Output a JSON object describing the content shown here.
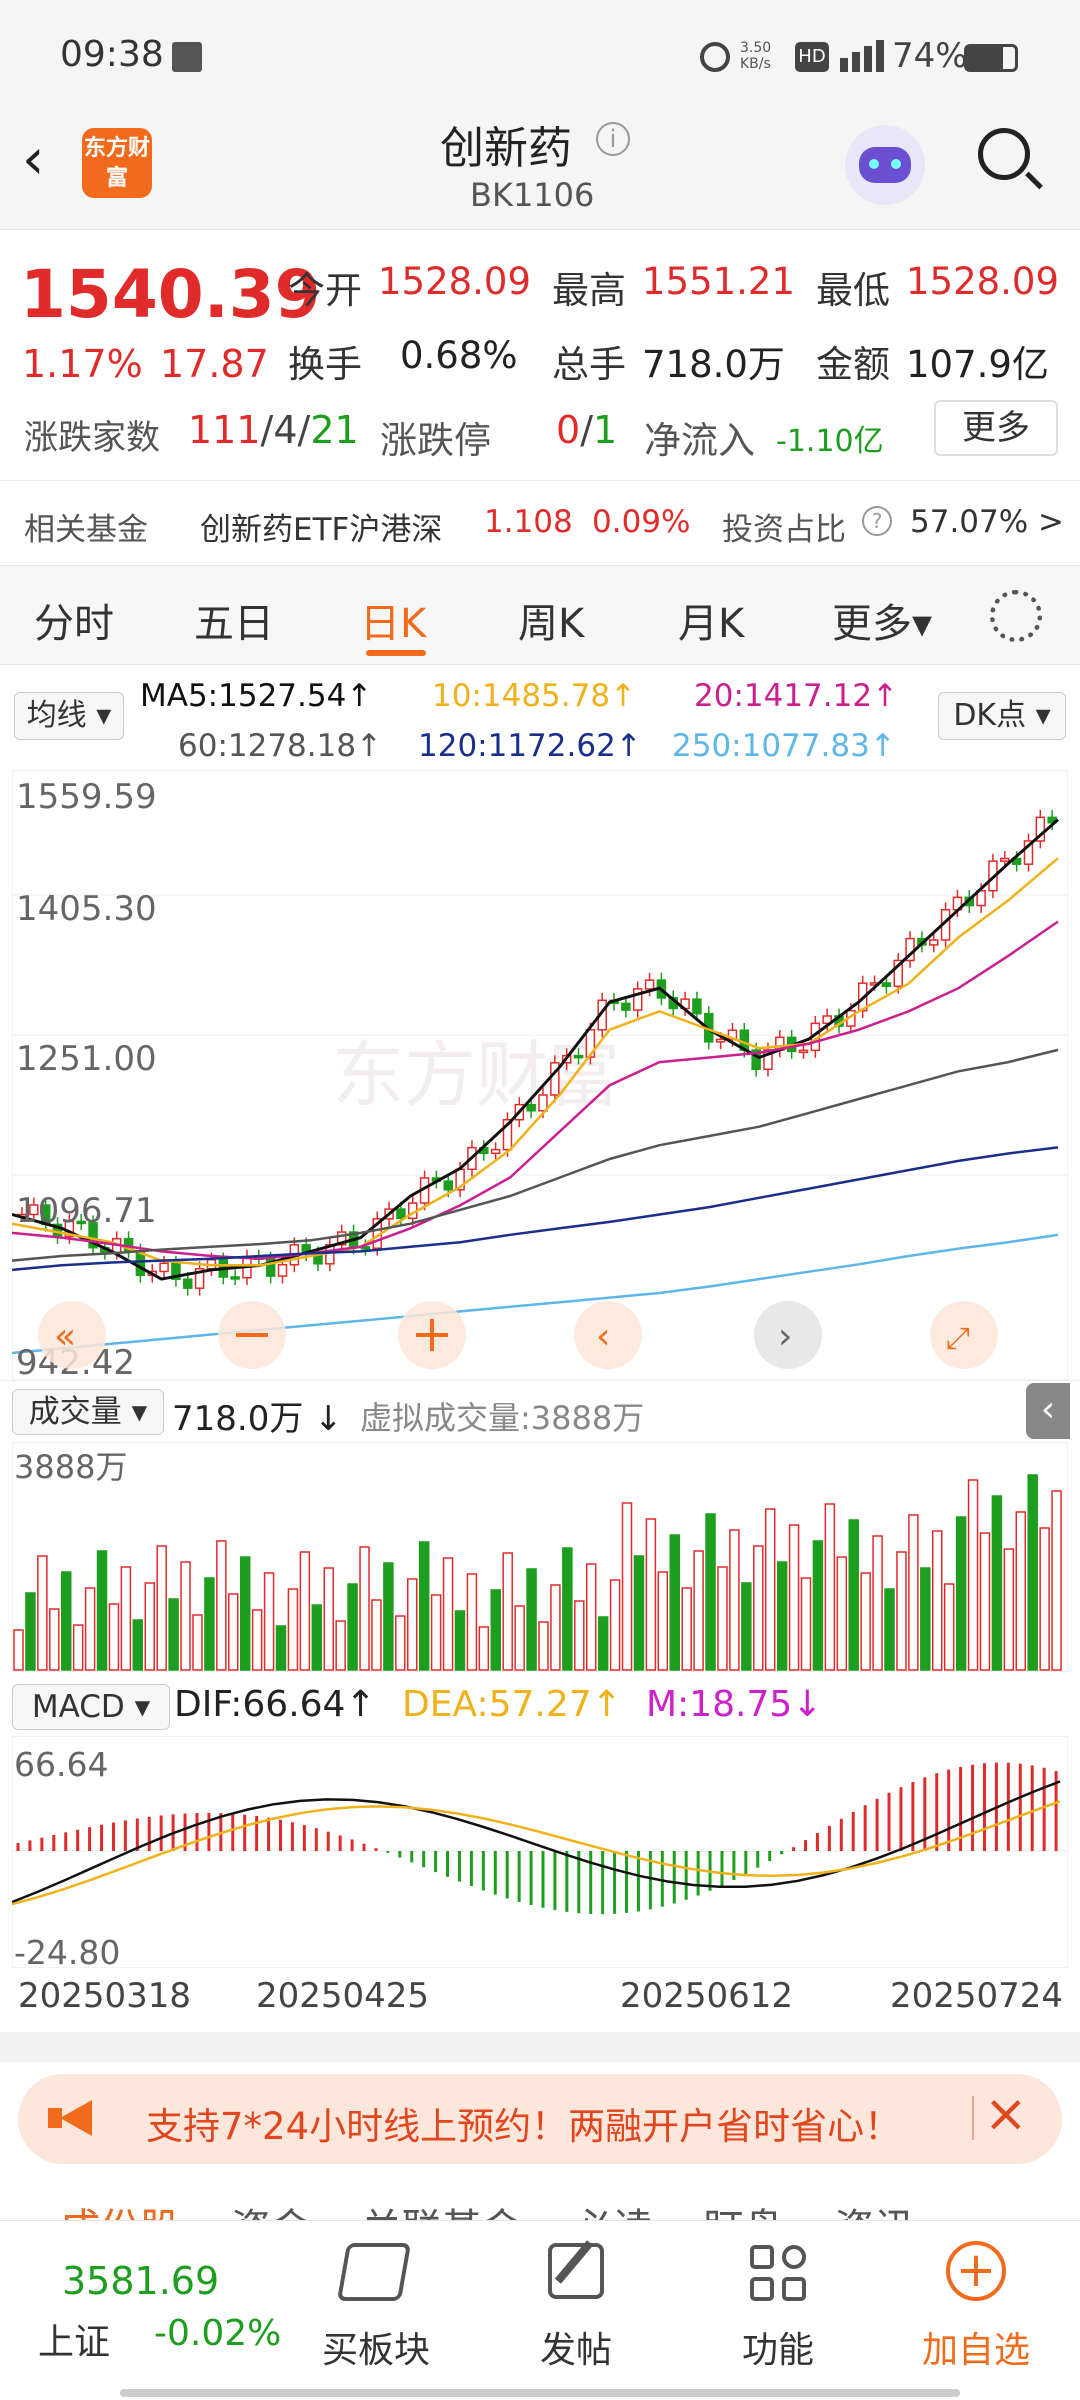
{
  "status": {
    "time": "09:38",
    "speed": "3.50 KB/s",
    "battery": "74%"
  },
  "header": {
    "logo": "东方财富",
    "title": "创新药",
    "code": "BK1106"
  },
  "quote": {
    "price": "1540.39",
    "pct": "1.17%",
    "change": "17.87",
    "open_label": "今开",
    "open": "1528.09",
    "high_label": "最高",
    "high": "1551.21",
    "low_label": "最低",
    "low": "1528.09",
    "turnover_label": "换手",
    "turnover": "0.68%",
    "vol_label": "总手",
    "vol": "718.0万",
    "amount_label": "金额",
    "amount": "107.9亿",
    "updown_label": "涨跌家数",
    "up": "111",
    "flat": "4",
    "down": "21",
    "limit_label": "涨跌停",
    "limit_up": "0",
    "limit_down": "1",
    "netflow_label": "净流入",
    "netflow": "-1.10亿",
    "more": "更多",
    "fund_label": "相关基金",
    "fund_name": "创新药ETF沪港深",
    "fund_price": "1.108",
    "fund_pct": "0.09%",
    "invest_label": "投资占比",
    "invest_pct": "57.07% >"
  },
  "tabs": [
    "分时",
    "五日",
    "日K",
    "周K",
    "月K",
    "更多▾"
  ],
  "ma": {
    "selector": "均线 ▾",
    "ma5": "MA5:1527.54↑",
    "ma10": "10:1485.78↑",
    "ma20": "20:1417.12↑",
    "ma60": "60:1278.18↑",
    "ma120": "120:1172.62↑",
    "ma250": "250:1077.83↑",
    "dk": "DK点 ▾"
  },
  "yaxis": [
    "1559.59",
    "1405.30",
    "1251.00",
    "1096.71",
    "942.42"
  ],
  "watermark": "东方财富",
  "volume": {
    "selector": "成交量 ▾",
    "value": "718.0万 ↓",
    "virtual": "虚拟成交量:3888万",
    "max": "3888万"
  },
  "macd": {
    "selector": "MACD ▾",
    "dif": "DIF:66.64↑",
    "dea": "DEA:57.27↑",
    "m": "M:18.75↓",
    "top": "66.64",
    "bottom": "-24.80"
  },
  "dates": [
    "20250318",
    "20250425",
    "20250612",
    "20250724"
  ],
  "banner": {
    "text": "支持7*24小时线上预约！两融开户省时省心！"
  },
  "subtabs": "成份股    资金    关联基金    必读    盯盘    资讯",
  "nav": {
    "index_value": "3581.69",
    "index_name": "上证",
    "index_pct": "-0.02%",
    "items": [
      "买板块",
      "发帖",
      "功能",
      "加自选"
    ]
  },
  "colors": {
    "up": "#e12b2b",
    "down": "#1e9e1e",
    "accent": "#f26b1d",
    "ma5": "#111111",
    "ma10": "#f0b21a",
    "ma20": "#cc1f8f",
    "ma60": "#555555",
    "ma120": "#1a2e8c",
    "ma250": "#5fb6e8"
  },
  "chart_data": {
    "type": "line",
    "title": "日K",
    "x_range": [
      "20250318",
      "20250724"
    ],
    "ylim": [
      942.42,
      1559.59
    ],
    "series": [
      {
        "name": "MA5",
        "values": [
          1100,
          1085,
          1060,
          1030,
          1040,
          1045,
          1060,
          1075,
          1120,
          1150,
          1200,
          1260,
          1330,
          1345,
          1300,
          1270,
          1290,
          1330,
          1380,
          1430,
          1480,
          1527.54
        ]
      },
      {
        "name": "MA10",
        "values": [
          1090,
          1080,
          1070,
          1050,
          1045,
          1045,
          1055,
          1065,
          1100,
          1130,
          1170,
          1230,
          1300,
          1320,
          1300,
          1280,
          1285,
          1320,
          1350,
          1400,
          1440,
          1485.78
        ]
      },
      {
        "name": "MA20",
        "values": [
          1080,
          1075,
          1068,
          1060,
          1055,
          1052,
          1058,
          1065,
          1085,
          1110,
          1140,
          1190,
          1240,
          1265,
          1270,
          1275,
          1285,
          1300,
          1320,
          1345,
          1380,
          1417.12
        ]
      },
      {
        "name": "MA60",
        "values": [
          1050,
          1055,
          1058,
          1062,
          1065,
          1068,
          1072,
          1080,
          1090,
          1105,
          1120,
          1140,
          1160,
          1175,
          1185,
          1195,
          1210,
          1225,
          1240,
          1255,
          1265,
          1278.18
        ]
      },
      {
        "name": "MA120",
        "values": [
          1040,
          1045,
          1048,
          1050,
          1052,
          1055,
          1058,
          1060,
          1065,
          1070,
          1078,
          1085,
          1092,
          1100,
          1108,
          1118,
          1128,
          1138,
          1148,
          1158,
          1166,
          1172.62
        ]
      },
      {
        "name": "MA250",
        "values": [
          950,
          955,
          960,
          965,
          970,
          975,
          980,
          985,
          990,
          995,
          1000,
          1005,
          1010,
          1015,
          1022,
          1030,
          1038,
          1046,
          1055,
          1063,
          1070,
          1077.83
        ]
      }
    ]
  }
}
